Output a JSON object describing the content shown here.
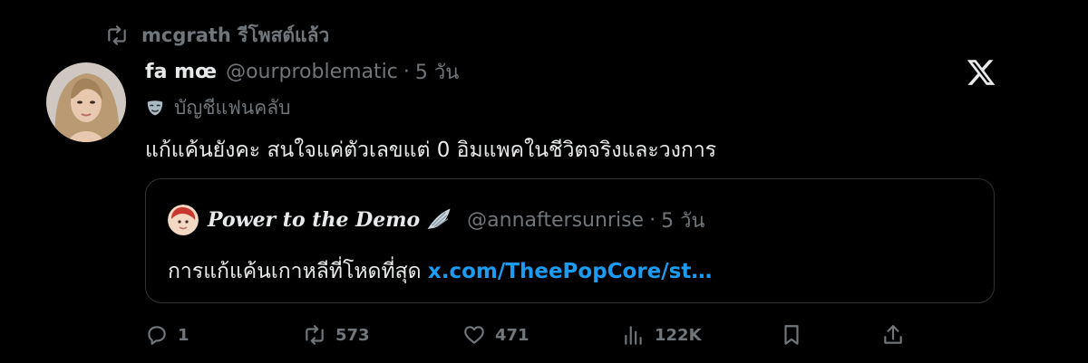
{
  "repost": {
    "user": "mcgrath",
    "label": "รีโพสต์แล้ว"
  },
  "tweet": {
    "display_name": "fa mœ",
    "handle": "@ourproblematic",
    "separator": "·",
    "time_ago": "5 วัน",
    "badge_label": "บัญชีแฟนคลับ",
    "text": "แก้แค้นยังคะ สนใจแค่ตัวเลขแต่ 0 อิมแพคในชีวิตจริงและวงการ"
  },
  "quote": {
    "display_name": "Power to the Demo",
    "handle": "@annaftersunrise",
    "separator": "·",
    "time_ago": "5 วัน",
    "text": "การแก้แค้นเกาหลีที่โหดที่สุด ",
    "link": "x.com/TheePopCore/st…"
  },
  "actions": {
    "replies": "1",
    "reposts": "573",
    "likes": "471",
    "views": "122K"
  },
  "colors": {
    "background": "#000000",
    "text": "#e7e9ea",
    "muted": "#71767b",
    "link": "#1d9bf0",
    "border": "#2f3336"
  },
  "icons": [
    "repost-icon",
    "x-logo-icon",
    "fan-club-mask-icon",
    "reply-icon",
    "like-icon",
    "views-icon",
    "bookmark-icon",
    "share-icon",
    "wing-icon"
  ]
}
